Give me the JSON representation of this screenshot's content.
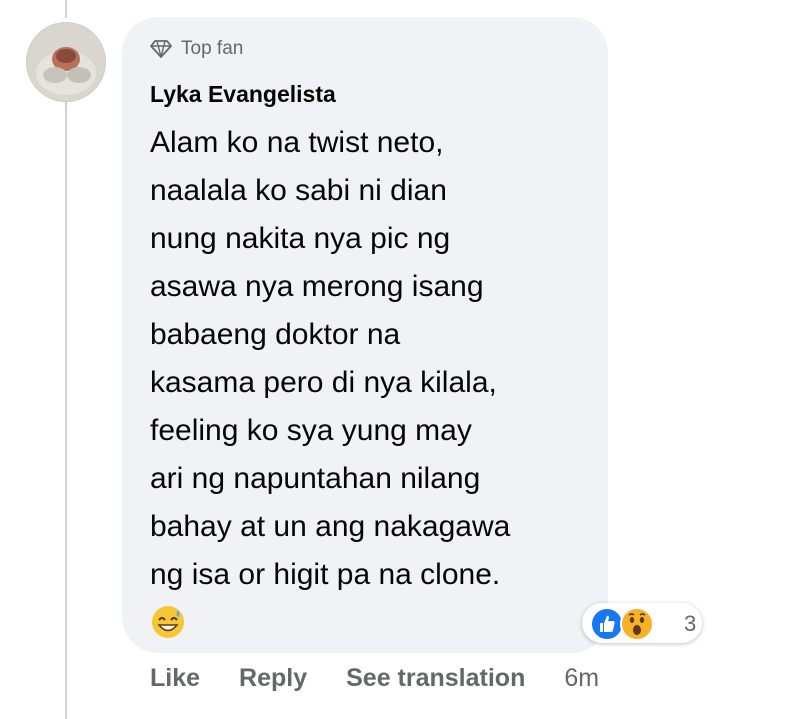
{
  "previous_reply_label": "Reply",
  "comment": {
    "badge": "Top fan",
    "author": "Lyka Evangelista",
    "text": "Alam ko na twist neto,\nnaalala ko sabi ni dian\nnung nakita nya pic ng\nasawa nya merong isang\nbabaeng doktor na\nkasama pero di nya kilala,\nfeeling ko sya yung may\nari ng napuntahan nilang\nbahay at un ang nakagawa\nng isa or higit pa na clone.",
    "emoji": "grinning-sweat-emoji",
    "reaction_icons": [
      "like-icon",
      "wow-icon"
    ],
    "reaction_count": "3"
  },
  "actions": {
    "like": "Like",
    "reply": "Reply",
    "see_translation": "See translation",
    "time": "6m"
  },
  "colors": {
    "bubble": "#f0f2f5",
    "secondary_text": "#65676b",
    "like_blue": "#1877f2",
    "wow_yellow": "#f7b125"
  }
}
